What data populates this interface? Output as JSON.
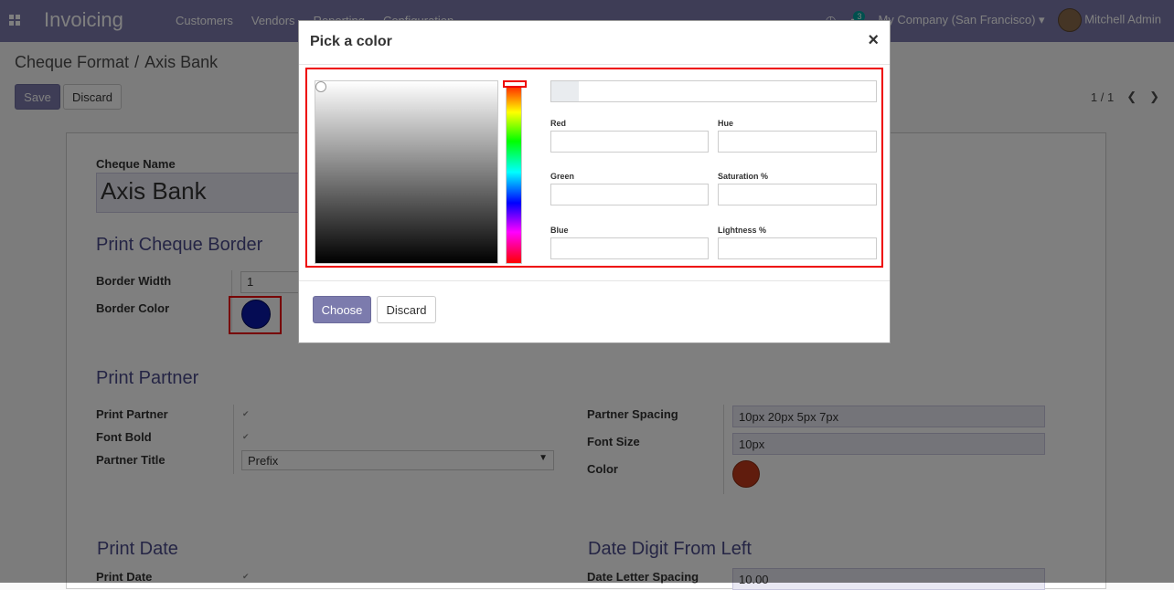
{
  "navbar": {
    "brand": "Invoicing",
    "menu": [
      "Customers",
      "Vendors",
      "Reporting",
      "Configuration"
    ],
    "badge_count": "3",
    "company": "My Company (San Francisco)",
    "user": "Mitchell Admin"
  },
  "breadcrumb": {
    "parent": "Cheque Format",
    "sep": "/",
    "current": "Axis Bank"
  },
  "actions": {
    "save": "Save",
    "discard": "Discard"
  },
  "pager": {
    "text": "1 / 1"
  },
  "form": {
    "cheque_name_label": "Cheque Name",
    "cheque_name_value": "Axis Bank",
    "border_section": "Print Cheque Border",
    "border_width_label": "Border Width",
    "border_width_value": "1",
    "border_color_label": "Border Color",
    "border_color": "#0a19a8",
    "partner_section": "Print Partner",
    "print_partner_label": "Print Partner",
    "font_bold_label": "Font Bold",
    "partner_title_label": "Partner Title",
    "partner_title_value": "Prefix",
    "partner_spacing_label": "Partner Spacing",
    "partner_spacing_value": "10px 20px 5px 7px",
    "font_size_label": "Font Size",
    "font_size_value": "10px",
    "color_label": "Color",
    "partner_color": "#c0391a",
    "date_section": "Print Date",
    "date_digit_section": "Date Digit From Left",
    "print_date_label": "Print Date",
    "date_letter_spacing_label": "Date Letter Spacing",
    "date_letter_spacing_value": "10.00"
  },
  "dialog": {
    "title": "Pick a color",
    "close": "×",
    "fields": {
      "red": "Red",
      "green": "Green",
      "blue": "Blue",
      "hue": "Hue",
      "saturation": "Saturation %",
      "lightness": "Lightness %"
    },
    "choose": "Choose",
    "discard": "Discard"
  },
  "colors": {
    "primary": "#7c7bad",
    "highlight": "#e00000"
  }
}
